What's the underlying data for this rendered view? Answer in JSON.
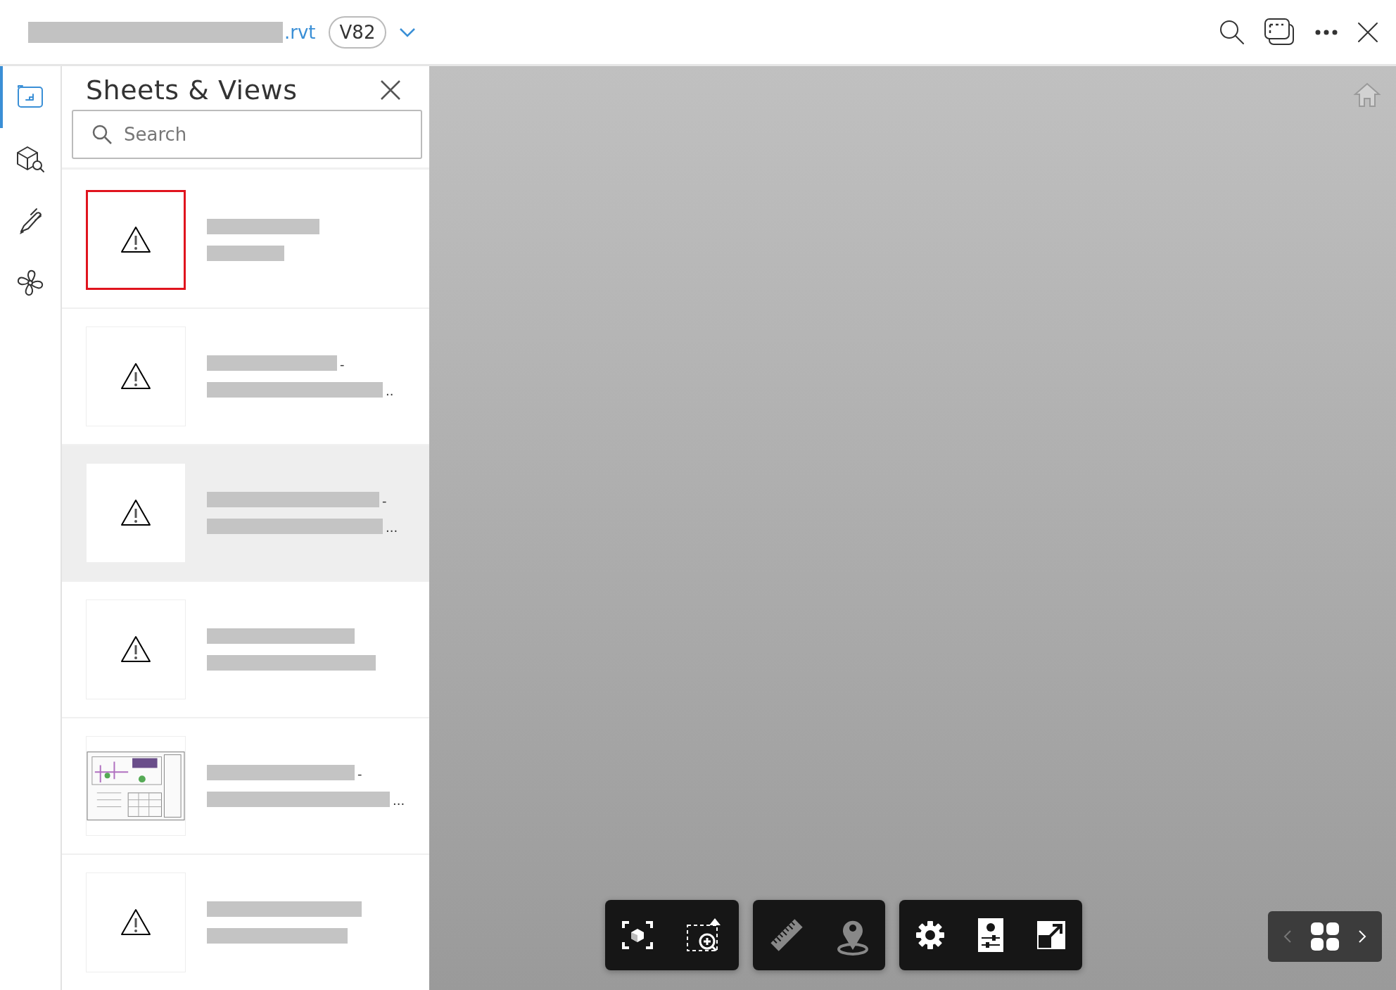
{
  "file": {
    "extension": ".rvt",
    "version": "V82"
  },
  "rail": [
    {
      "kind": "sheets",
      "selected": true
    },
    {
      "kind": "model-browser",
      "selected": false
    },
    {
      "kind": "markup",
      "selected": false
    },
    {
      "kind": "systems",
      "selected": false
    }
  ],
  "panel": {
    "title": "Sheets & Views",
    "search": {
      "placeholder": "Search"
    },
    "items": [
      {
        "kind": "warning",
        "flagged": true,
        "selected": false
      },
      {
        "kind": "warning",
        "flagged": false,
        "selected": false,
        "title_end": "-",
        "subtitle_end": ".."
      },
      {
        "kind": "warning",
        "flagged": false,
        "selected": true,
        "title_end": "-",
        "subtitle_end": "..."
      },
      {
        "kind": "warning",
        "flagged": false,
        "selected": false
      },
      {
        "kind": "drawing",
        "flagged": false,
        "selected": false,
        "title_end": "-",
        "subtitle_end": "..."
      },
      {
        "kind": "warning",
        "flagged": false,
        "selected": false
      }
    ]
  },
  "toolbar": [
    {
      "tools": [
        {
          "kind": "fit"
        },
        {
          "kind": "zoom-window"
        }
      ]
    },
    {
      "tools": [
        {
          "kind": "measure"
        },
        {
          "kind": "location"
        }
      ]
    },
    {
      "tools": [
        {
          "kind": "settings"
        },
        {
          "kind": "properties"
        },
        {
          "kind": "fullscreen"
        }
      ]
    }
  ]
}
